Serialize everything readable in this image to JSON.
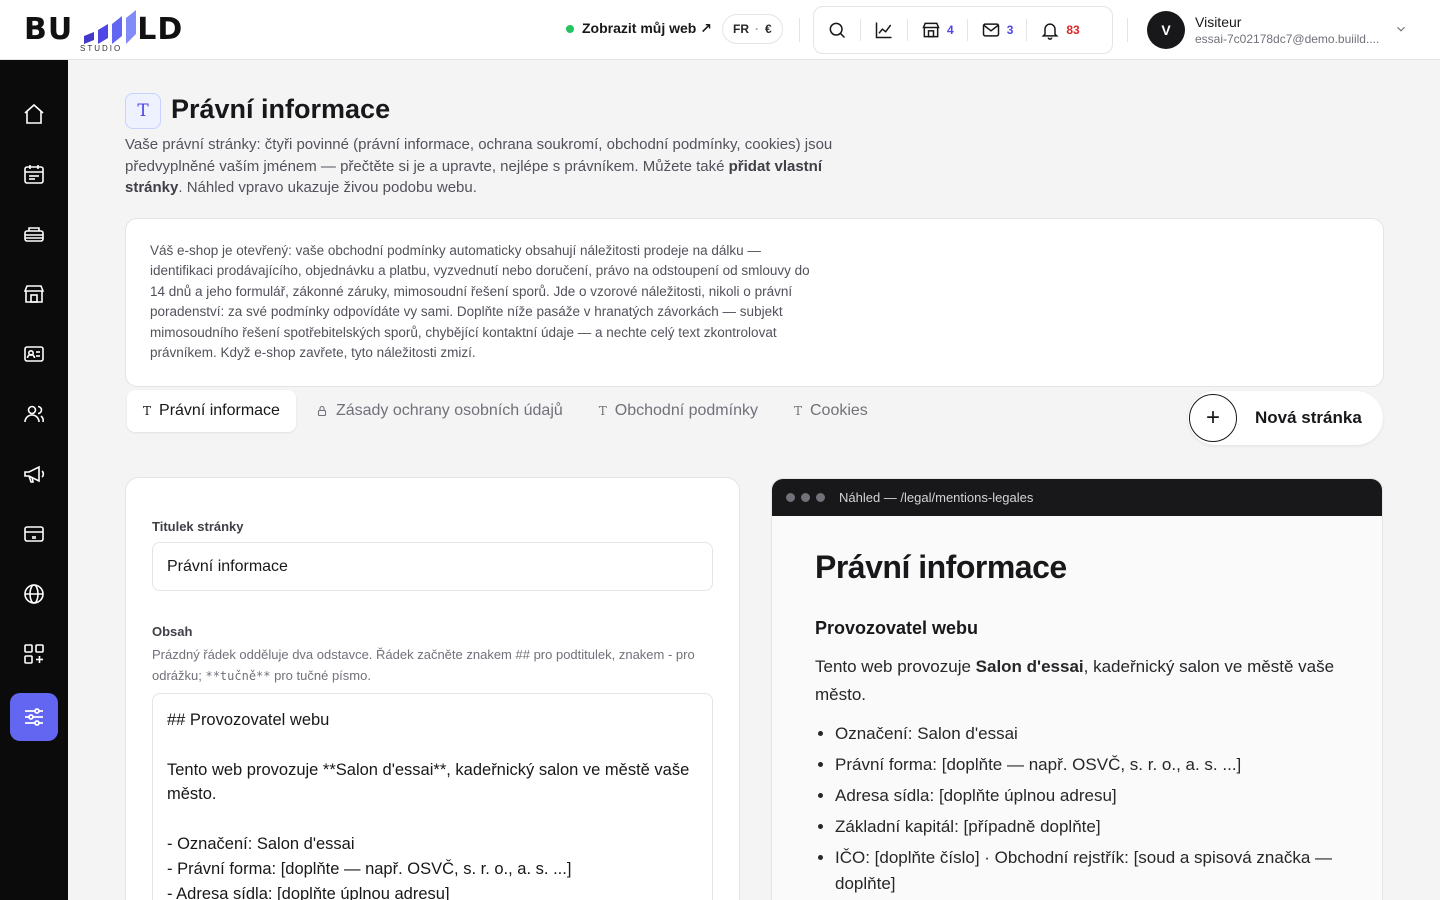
{
  "brand": {
    "logo_text_left": "BU",
    "logo_text_right": "LD",
    "logo_sub": "STUDIO"
  },
  "header": {
    "view_site": "Zobrazit můj web ↗",
    "lang": "FR",
    "currency": "€",
    "counts": {
      "shop": "4",
      "mail": "3",
      "notifications": "83"
    },
    "user": {
      "initial": "V",
      "name": "Visiteur",
      "email": "essai-7c02178dc7@demo.buiild...."
    }
  },
  "sidebar": {
    "items": [
      {
        "icon": "home-icon"
      },
      {
        "icon": "calendar-icon"
      },
      {
        "icon": "services-icon"
      },
      {
        "icon": "store-icon"
      },
      {
        "icon": "contact-card-icon"
      },
      {
        "icon": "users-icon"
      },
      {
        "icon": "megaphone-icon"
      },
      {
        "icon": "payment-card-icon"
      },
      {
        "icon": "globe-icon"
      },
      {
        "icon": "apps-icon"
      },
      {
        "icon": "sliders-icon"
      }
    ],
    "active_index": 10
  },
  "page": {
    "title": "Právní informace",
    "desc_1": "Vaše právní stránky: čtyři povinné (právní informace, ochrana soukromí, obchodní podmínky, cookies) jsou předvyplněné vaším jménem — přečtěte si je a upravte, nejlépe s právníkem. Můžete také ",
    "desc_bold": "přidat vlastní stránky",
    "desc_2": ". Náhled vpravo ukazuje živou podobu webu.",
    "notice": "Váš e-shop je otevřený: vaše obchodní podmínky automaticky obsahují náležitosti prodeje na dálku — identifikaci prodávajícího, objednávku a platbu, vyzvednutí nebo doručení, právo na odstoupení od smlouvy do 14 dnů a jeho formulář, zákonné záruky, mimosoudní řešení sporů. Jde o vzorové náležitosti, nikoli o právní poradenství: za své podmínky odpovídáte vy sami. Doplňte níže pasáže v hranatých závorkách — subjekt mimosoudního řešení spotřebitelských sporů, chybějící kontaktní údaje — a nechte celý text zkontrolovat právníkem. Když e-shop zavřete, tyto náležitosti zmizí."
  },
  "tabs": [
    {
      "icon": "T",
      "label": "Právní informace",
      "active": true
    },
    {
      "icon": "🔒",
      "label": "Zásady ochrany osobních údajů",
      "active": false
    },
    {
      "icon": "T",
      "label": "Obchodní podmínky",
      "active": false
    },
    {
      "icon": "T",
      "label": "Cookies",
      "active": false
    }
  ],
  "new_page": {
    "label": "Nová stránka"
  },
  "editor": {
    "title_label": "Titulek stránky",
    "title_value": "Právní informace",
    "content_label": "Obsah",
    "help_1": "Prázdný řádek odděluje dva odstavce. Řádek začněte znakem ## pro podtitulek, znakem - pro odrážku; ",
    "help_code": "**tučně**",
    "help_2": " pro tučné písmo.",
    "content": "## Provozovatel webu\n\nTento web provozuje **Salon d'essai**, kadeřnický salon ve městě vaše město.\n\n- Označení: Salon d'essai\n- Právní forma: [doplňte — např. OSVČ, s. r. o., a. s. ...]\n- Adresa sídla: [doplňte úplnou adresu]"
  },
  "preview": {
    "url": "Náhled — /legal/mentions-legales",
    "h1": "Právní informace",
    "h2": "Provozovatel webu",
    "p_1": "Tento web provozuje ",
    "p_bold": "Salon d'essai",
    "p_2": ", kadeřnický salon ve městě vaše město.",
    "list": [
      "Označení: Salon d'essai",
      "Právní forma: [doplňte — např. OSVČ, s. r. o., a. s. ...]",
      "Adresa sídla: [doplňte úplnou adresu]",
      "Základní kapitál: [případně doplňte]",
      "IČO: [doplňte číslo] · Obchodní rejstřík: [soud a spisová značka — doplňte]"
    ]
  },
  "colors": {
    "accent": "#6366f1",
    "live": "#22c55e",
    "alert": "#dc2626",
    "sidebar": "#0b0b0c"
  }
}
